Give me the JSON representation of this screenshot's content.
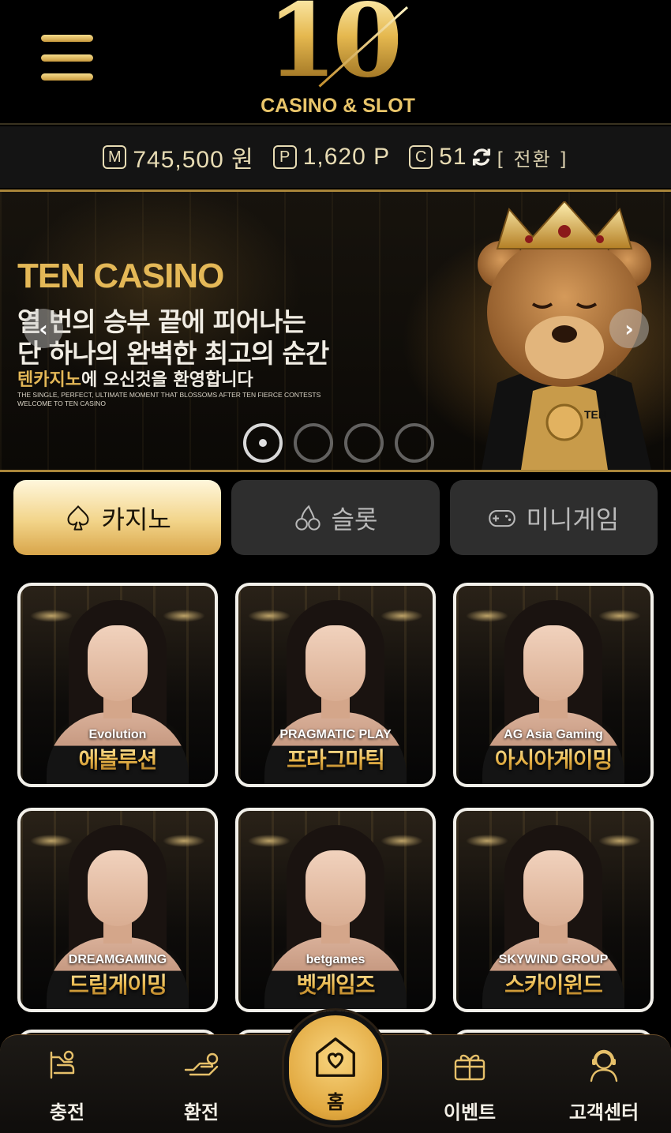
{
  "header": {
    "logo_number": "10",
    "logo_subtitle": "CASINO & SLOT",
    "menu_icon": "hamburger-menu-icon"
  },
  "balance": {
    "money_badge": "M",
    "money_value": "745,500 원",
    "point_badge": "P",
    "point_value": "1,620 P",
    "coin_badge": "C",
    "coin_value": "51",
    "convert_label": "[ 전환 ]"
  },
  "banner": {
    "title": "TEN CASINO",
    "line1": "열 번의 승부 끝에 피어나는",
    "line2": "단 하나의 완벽한 최고의 순간",
    "welcome_highlight": "텐카지노",
    "welcome_rest": "에 오신것을 환영합니다",
    "english_line1": "THE SINGLE, PERFECT, ULTIMATE MOMENT THAT BLOSSOMS AFTER TEN FIERCE CONTESTS",
    "english_line2": "WELCOME TO TEN CASINO",
    "bear_shirt_text": "TEN",
    "prev_arrow": "‹",
    "next_arrow": "›",
    "active_slide": 1,
    "slide_count": 4
  },
  "tabs": [
    {
      "label": "카지노",
      "icon": "spade-icon",
      "active": true
    },
    {
      "label": "슬롯",
      "icon": "cherry-icon",
      "active": false
    },
    {
      "label": "미니게임",
      "icon": "gamepad-icon",
      "active": false
    }
  ],
  "games": [
    {
      "provider_logo": "Evolution",
      "label": "에볼루션"
    },
    {
      "provider_logo": "PRAGMATIC PLAY",
      "label": "프라그마틱"
    },
    {
      "provider_logo": "AG Asia Gaming",
      "label": "아시아게이밍"
    },
    {
      "provider_logo": "DREAMGAMING",
      "label": "드림게이밍"
    },
    {
      "provider_logo": "betgames",
      "label": "벳게임즈"
    },
    {
      "provider_logo": "SKYWIND GROUP",
      "label": "스카이윈드"
    }
  ],
  "bottom_nav": {
    "charge": "충전",
    "exchange": "환전",
    "home": "홈",
    "event": "이벤트",
    "support": "고객센터"
  },
  "colors": {
    "gold": "#e4b857",
    "background": "#000000",
    "tab_inactive": "#2e2e2e"
  }
}
